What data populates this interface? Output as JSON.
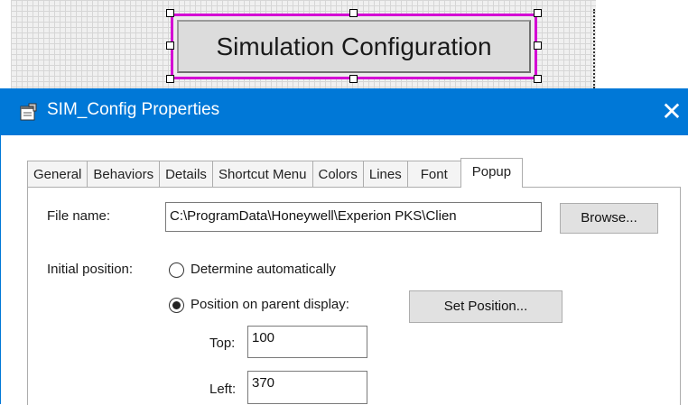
{
  "canvas": {
    "object_label": "Simulation Configuration",
    "selection_color": "#d400d4"
  },
  "dialog": {
    "title": "SIM_Config Properties",
    "title_bar_color": "#0078d7",
    "close_glyph": "✕",
    "tabs": [
      "General",
      "Behaviors",
      "Details",
      "Shortcut Menu",
      "Colors",
      "Lines",
      "Font",
      "Popup"
    ],
    "active_tab": "Popup",
    "file_name": {
      "label": "File name:",
      "value": "C:\\ProgramData\\Honeywell\\Experion PKS\\Clien",
      "browse_label": "Browse..."
    },
    "initial_position": {
      "label": "Initial position:",
      "options": [
        {
          "label": "Determine automatically",
          "selected": false
        },
        {
          "label": "Position on parent display:",
          "selected": true
        }
      ],
      "set_position_label": "Set Position...",
      "top_label": "Top:",
      "top_value": "100",
      "left_label": "Left:",
      "left_value": "370"
    }
  }
}
